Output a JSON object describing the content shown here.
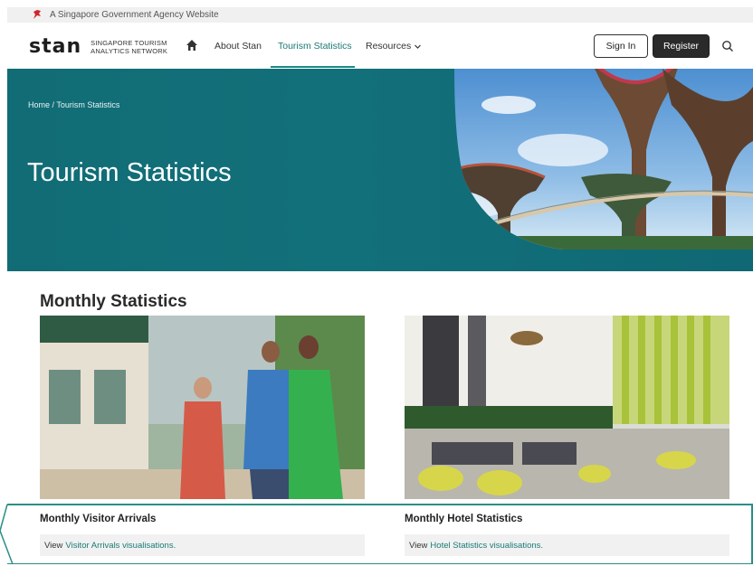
{
  "gov_bar": {
    "text": "A Singapore Government Agency Website"
  },
  "nav": {
    "logo_mark": "stan",
    "logo_line1": "SINGAPORE TOURISM",
    "logo_line2": "ANALYTICS NETWORK",
    "links": [
      {
        "label": "About Stan"
      },
      {
        "label": "Tourism Statistics"
      },
      {
        "label": "Resources"
      }
    ],
    "sign_in": "Sign In",
    "register": "Register"
  },
  "hero": {
    "breadcrumb": "Home  /  Tourism Statistics",
    "title": "Tourism Statistics"
  },
  "section": {
    "title": "Monthly Statistics"
  },
  "cards": [
    {
      "title": "Monthly Visitor Arrivals",
      "view_prefix": "View",
      "link": "Visitor Arrivals visualisations."
    },
    {
      "title": "Monthly Hotel Statistics",
      "view_prefix": "View",
      "link": "Hotel Statistics visualisations."
    }
  ],
  "colors": {
    "teal": "#12707a",
    "accent_link": "#1a7a76",
    "lion_red": "#d0252c"
  }
}
